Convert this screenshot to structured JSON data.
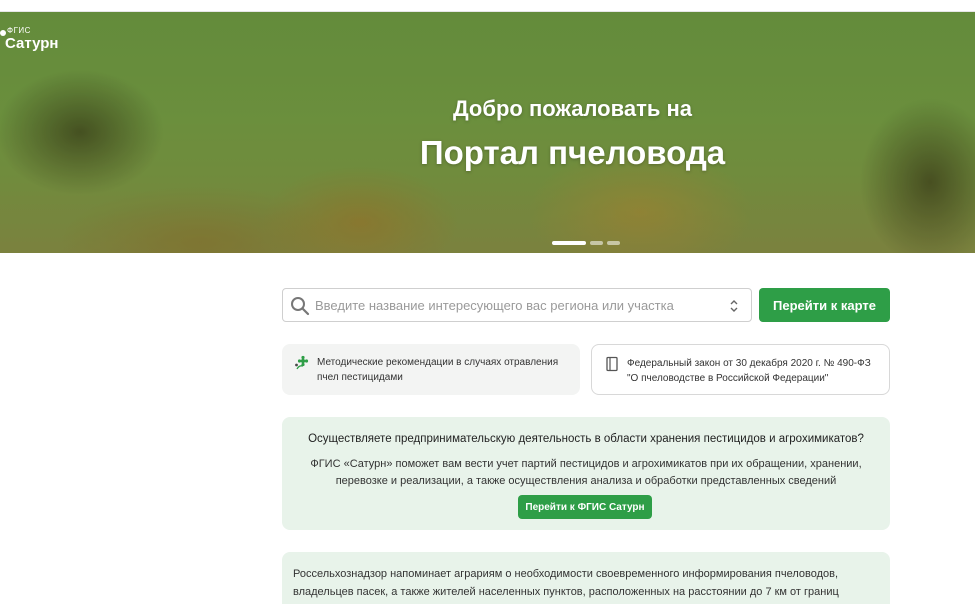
{
  "logo": {
    "small": "ФГИС",
    "big": "Сатурн"
  },
  "hero": {
    "line1": "Добро пожаловать на",
    "line2": "Портал пчеловода",
    "slides": [
      {
        "active": true
      },
      {
        "active": false
      },
      {
        "active": false
      }
    ]
  },
  "search": {
    "placeholder": "Введите название интересующего вас региона или участка",
    "icon": "search-icon",
    "toggle_icon": "chevron-updown-icon"
  },
  "map_button": {
    "label": "Перейти к карте"
  },
  "cards": [
    {
      "icon": "bee-flower-icon",
      "text": "Методические рекомендации в случаях отравления пчел пестицидами"
    },
    {
      "icon": "document-icon",
      "text": "Федеральный закон от 30 декабря 2020 г. № 490-ФЗ \"О пчеловодстве в Российской Федерации\""
    }
  ],
  "promo": {
    "title": "Осуществляете предпринимательскую деятельность в области хранения пестицидов и агрохимикатов?",
    "text": "ФГИС «Сатурн» поможет вам вести учет партий пестицидов и агрохимикатов при их обращении, хранении, перевозке и реализации, а также осуществления анализа и обработки представленных сведений",
    "button": "Перейти к ФГИС Сатурн"
  },
  "notice": {
    "text": "Россельхознадзор напоминает аграриям о необходимости своевременного информирования пчеловодов, владельцев пасек, а также жителей населенных пунктов, расположенных на расстоянии до 7 км от границ"
  },
  "colors": {
    "accent": "#2e9e47",
    "promo_bg": "#e8f3ea"
  }
}
